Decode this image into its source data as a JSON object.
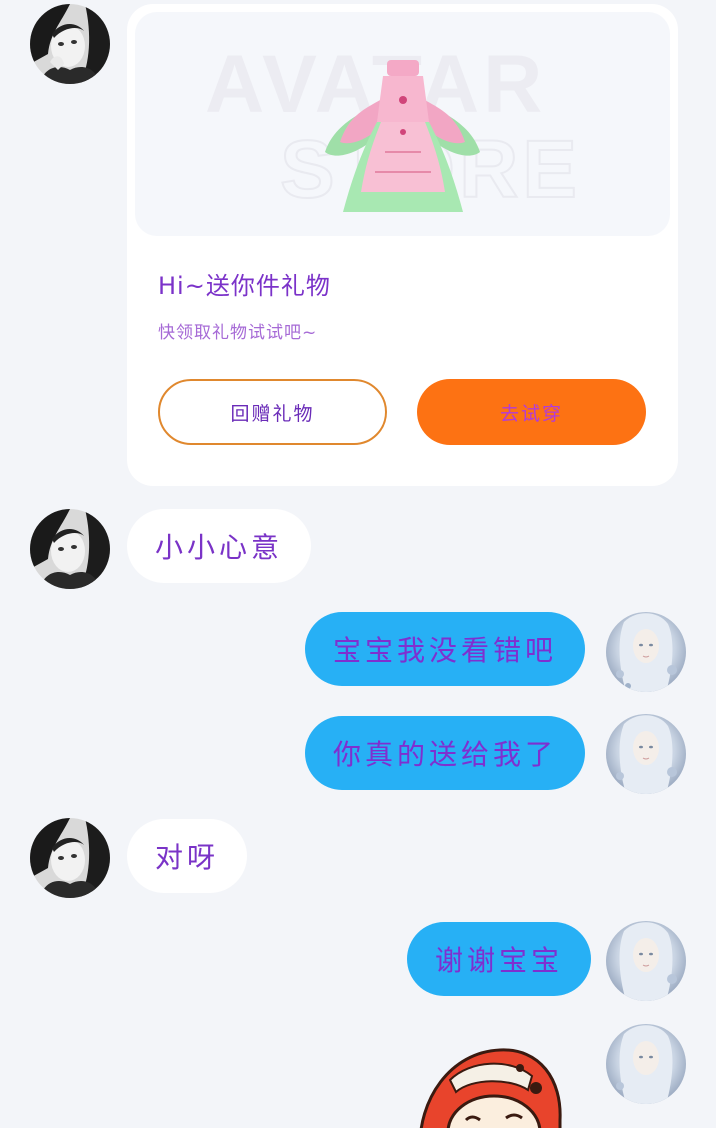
{
  "gift_card": {
    "image_watermark_line1": "AVATAR",
    "image_watermark_line2": "STORE",
    "title": "Hi~送你件礼物",
    "subtitle": "快领取礼物试试吧~",
    "return_gift_label": "回赠礼物",
    "try_on_label": "去试穿"
  },
  "messages": [
    {
      "side": "left",
      "text": "小小心意"
    },
    {
      "side": "right",
      "text": "宝宝我没看错吧"
    },
    {
      "side": "right",
      "text": "你真的送给我了"
    },
    {
      "side": "left",
      "text": "对呀"
    },
    {
      "side": "right",
      "text": "谢谢宝宝"
    }
  ],
  "colors": {
    "background": "#f3f5f9",
    "incoming_bubble": "#ffffff",
    "outgoing_bubble": "#27b0f5",
    "text_purple": "#7a33c7",
    "accent_orange": "#fd7213"
  },
  "icons": {
    "friend_avatar": "friend-avatar-bw-photo",
    "self_avatar": "self-avatar-doll-photo",
    "gift_image": "dress-outfit-icon",
    "sticker": "cartoon-sticker"
  }
}
